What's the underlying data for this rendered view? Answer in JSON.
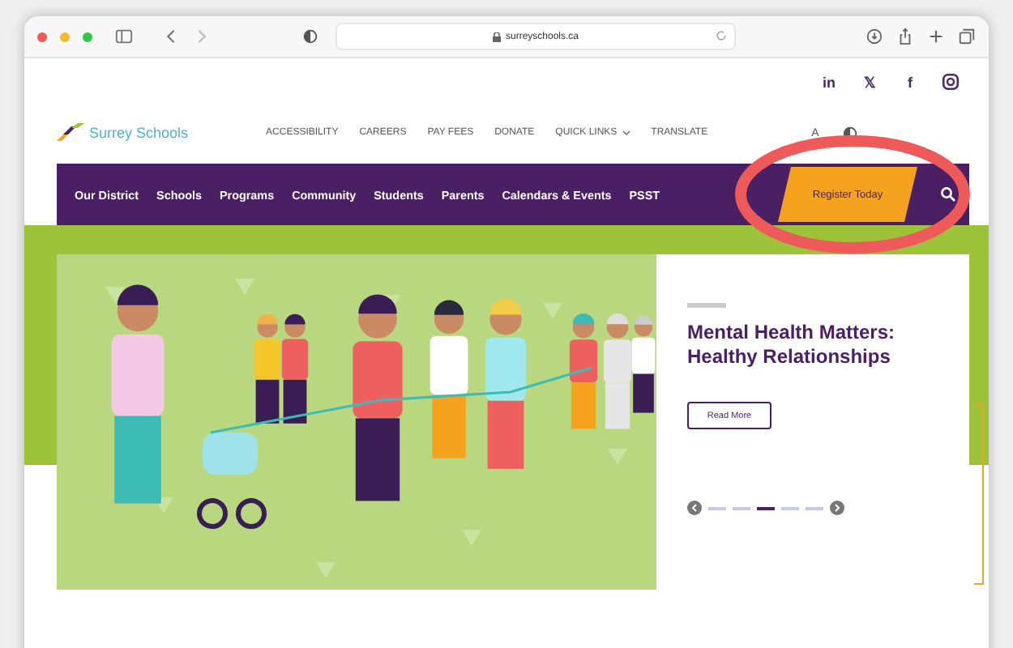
{
  "browser": {
    "url": "surreyschools.ca"
  },
  "social": [
    {
      "kind": "linkedin",
      "label": "in"
    },
    {
      "kind": "x",
      "label": "𝕏"
    },
    {
      "kind": "facebook",
      "label": "f"
    },
    {
      "kind": "instagram"
    }
  ],
  "logo": {
    "name": "Surrey Schools"
  },
  "utility_links": [
    {
      "label": "ACCESSIBILITY",
      "dropdown": false
    },
    {
      "label": "CAREERS",
      "dropdown": false
    },
    {
      "label": "PAY FEES",
      "dropdown": false
    },
    {
      "label": "DONATE",
      "dropdown": false
    },
    {
      "label": "QUICK LINKS",
      "dropdown": true
    },
    {
      "label": "TRANSLATE",
      "dropdown": false
    }
  ],
  "text_size": {
    "label": "A"
  },
  "nav": [
    {
      "label": "Our District"
    },
    {
      "label": "Schools"
    },
    {
      "label": "Programs"
    },
    {
      "label": "Community"
    },
    {
      "label": "Students"
    },
    {
      "label": "Parents"
    },
    {
      "label": "Calendars & Events"
    },
    {
      "label": "PSST"
    }
  ],
  "cta": {
    "label": "Register Today"
  },
  "hero": {
    "title": "Mental Health Matters: Healthy Relationships",
    "button": "Read More",
    "slides": [
      {
        "selected": false
      },
      {
        "selected": false
      },
      {
        "selected": true
      },
      {
        "selected": false
      },
      {
        "selected": false
      }
    ]
  },
  "annotation": {
    "kind": "ellipse",
    "color": "#ee5a5a"
  }
}
